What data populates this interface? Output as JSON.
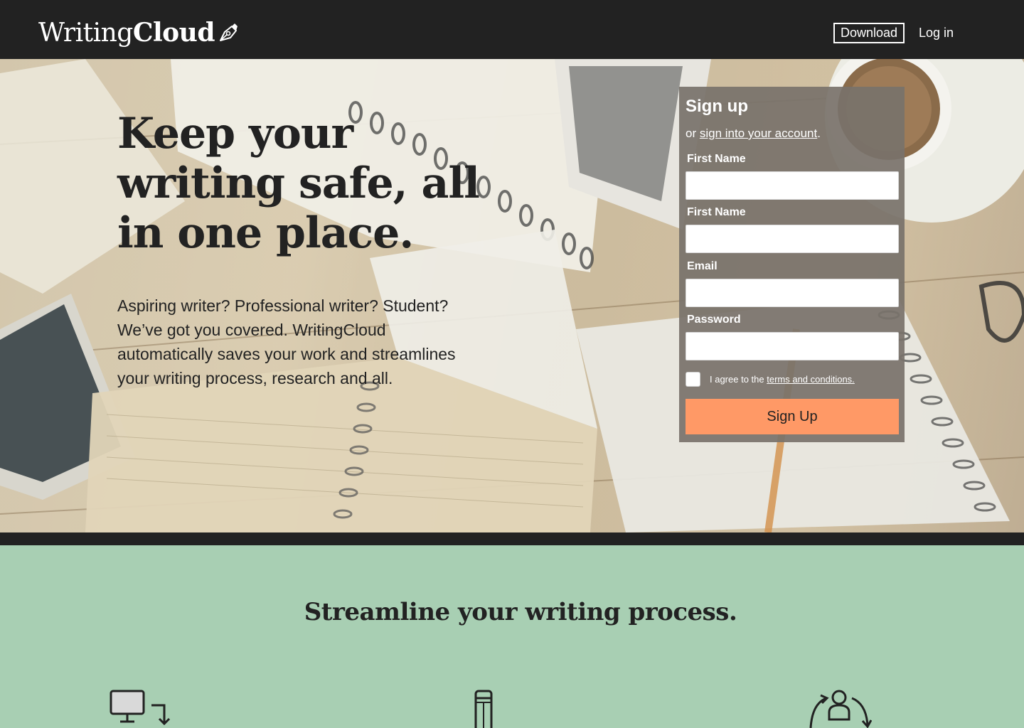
{
  "header": {
    "logo_light": "Writing",
    "logo_bold": "Cloud",
    "download_label": "Download",
    "login_label": "Log in"
  },
  "hero": {
    "title_line1": "Keep your",
    "title_line2": "writing safe, all",
    "title_line3": "in one place.",
    "description": "Aspiring writer? Professional writer? Student? We’ve got you covered. WritingCloud automatically saves your work and streamlines your writing process, research and all."
  },
  "signup": {
    "title": "Sign up",
    "or_prefix": "or ",
    "signin_link": "sign into your account",
    "or_suffix": ".",
    "fields": [
      {
        "label": "First Name",
        "value": ""
      },
      {
        "label": "First Name",
        "value": ""
      },
      {
        "label": "Email",
        "value": ""
      },
      {
        "label": "Password",
        "value": ""
      }
    ],
    "agree_prefix": "I agree to the ",
    "terms_link": "terms and conditions.",
    "submit_label": "Sign Up",
    "accent_color": "#ff9966"
  },
  "features": {
    "heading": "Streamline your writing process.",
    "icons": [
      "computer-download-icon",
      "pencil-icon",
      "user-sync-icon"
    ]
  },
  "colors": {
    "header_bg": "#222222",
    "features_bg": "#a8cfb3",
    "text_dark": "#222222"
  }
}
